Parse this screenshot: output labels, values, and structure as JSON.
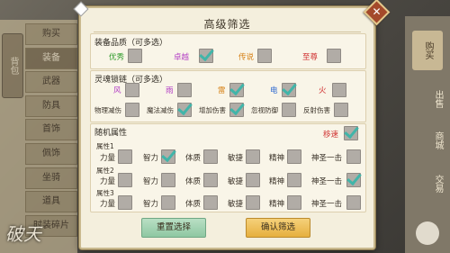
{
  "background": {
    "left_sidebar": {
      "tab": "背包",
      "items": [
        "购买",
        "装备",
        "武器",
        "防具",
        "首饰",
        "佩饰",
        "坐骑",
        "道具",
        "时装碎片"
      ],
      "active_index": 1
    },
    "right_sidebar": {
      "banner": "购买",
      "items": [
        "出售",
        "商城",
        "交易"
      ]
    },
    "logo_text": "破天"
  },
  "modal": {
    "title": "高级筛选",
    "close_glyph": "✕",
    "quality": {
      "header": "装备品质（可多选）",
      "options": [
        {
          "label": "优秀",
          "color": "#2f9b2a",
          "checked": false
        },
        {
          "label": "卓越",
          "color": "#b33ec4",
          "checked": true
        },
        {
          "label": "传说",
          "color": "#d68116",
          "checked": false
        },
        {
          "label": "至尊",
          "color": "#cf2d2d",
          "checked": false
        }
      ]
    },
    "soul_chain": {
      "header": "灵魂锁链（可多选）",
      "elements": [
        {
          "label": "风",
          "color": "#b33ec4",
          "checked": false
        },
        {
          "label": "雨",
          "color": "#b33ec4",
          "checked": false
        },
        {
          "label": "雷",
          "color": "#d68116",
          "checked": true
        },
        {
          "label": "电",
          "color": "#2f6ad0",
          "checked": true
        },
        {
          "label": "火",
          "color": "#cf2d2d",
          "checked": false
        }
      ],
      "effects": [
        {
          "label": "物理减伤",
          "checked": false
        },
        {
          "label": "魔法减伤",
          "checked": true
        },
        {
          "label": "增加伤害",
          "checked": true
        },
        {
          "label": "忽视防御",
          "checked": false
        },
        {
          "label": "反射伤害",
          "checked": false
        }
      ]
    },
    "random_attr": {
      "header": "随机属性",
      "toggle_label": "移速",
      "toggle_checked": true,
      "rows": [
        {
          "label": "属性1",
          "attrs": [
            {
              "label": "力量",
              "checked": false
            },
            {
              "label": "智力",
              "checked": true
            },
            {
              "label": "体质",
              "checked": false
            },
            {
              "label": "敏捷",
              "checked": false
            },
            {
              "label": "精神",
              "checked": false
            },
            {
              "label": "神圣一击",
              "checked": false
            }
          ]
        },
        {
          "label": "属性2",
          "attrs": [
            {
              "label": "力量",
              "checked": false
            },
            {
              "label": "智力",
              "checked": false
            },
            {
              "label": "体质",
              "checked": false
            },
            {
              "label": "敏捷",
              "checked": false
            },
            {
              "label": "精神",
              "checked": false
            },
            {
              "label": "神圣一击",
              "checked": true
            }
          ]
        },
        {
          "label": "属性3",
          "attrs": [
            {
              "label": "力量",
              "checked": false
            },
            {
              "label": "智力",
              "checked": false
            },
            {
              "label": "体质",
              "checked": false
            },
            {
              "label": "敏捷",
              "checked": false
            },
            {
              "label": "精神",
              "checked": false
            },
            {
              "label": "神圣一击",
              "checked": false
            }
          ]
        }
      ]
    },
    "buttons": {
      "reset": "重置选择",
      "confirm": "确认筛选"
    }
  }
}
